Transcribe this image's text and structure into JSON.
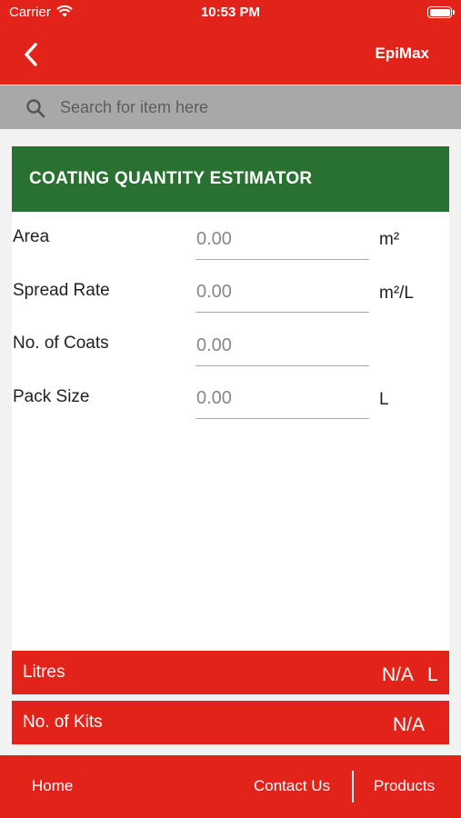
{
  "status": {
    "carrier": "Carrier",
    "time": "10:53 PM"
  },
  "nav": {
    "brand": "EpiMax"
  },
  "search": {
    "placeholder": "Search for item here"
  },
  "panel": {
    "title": "COATING QUANTITY ESTIMATOR",
    "rows": [
      {
        "label": "Area",
        "placeholder": "0.00",
        "unit": "m²"
      },
      {
        "label": "Spread Rate",
        "placeholder": "0.00",
        "unit": "m²/L"
      },
      {
        "label": "No. of Coats",
        "placeholder": "0.00",
        "unit": ""
      },
      {
        "label": "Pack Size",
        "placeholder": "0.00",
        "unit": "L"
      }
    ]
  },
  "results": {
    "litres": {
      "label": "Litres",
      "value": "N/A",
      "unit": "L"
    },
    "kits": {
      "label": "No. of Kits",
      "value": "N/A"
    }
  },
  "tabs": {
    "home": "Home",
    "contact": "Contact Us",
    "products": "Products"
  },
  "colors": {
    "brand_red": "#e2231a",
    "header_green": "#287131",
    "search_gray": "#a8a8a8"
  }
}
